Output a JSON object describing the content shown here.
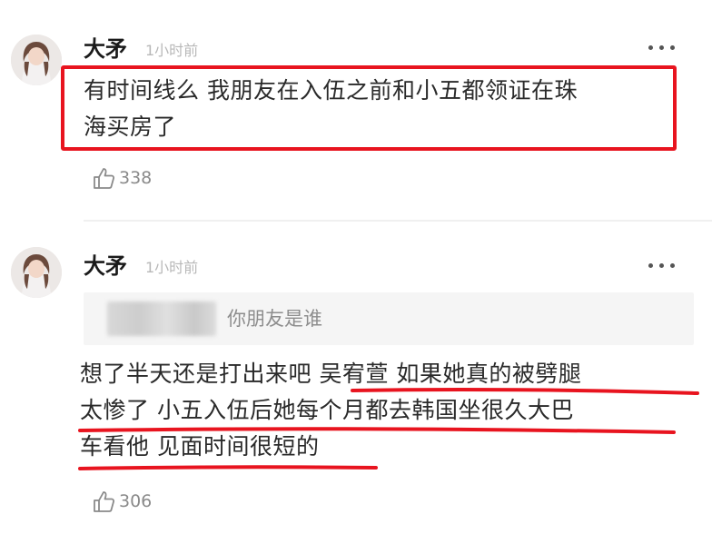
{
  "comments": [
    {
      "username": "大矛",
      "time": "1小时前",
      "text_lines": [
        "有时间线么 我朋友在入伍之前和小五都领证在珠",
        "海买房了"
      ],
      "likes": "338"
    },
    {
      "username": "大矛",
      "time": "1小时前",
      "quote": {
        "author": "",
        "text": "你朋友是谁"
      },
      "text_lines": [
        "想了半天还是打出来吧 吴宥萱 如果她真的被劈腿",
        "太惨了 小五入伍后她每个月都去韩国坐很久大巴",
        "车看他 见面时间很短的"
      ],
      "likes": "306"
    }
  ],
  "annotation_color": "#e8141f",
  "icons": {
    "more": "more-dots-icon",
    "like": "thumbs-up-icon"
  }
}
